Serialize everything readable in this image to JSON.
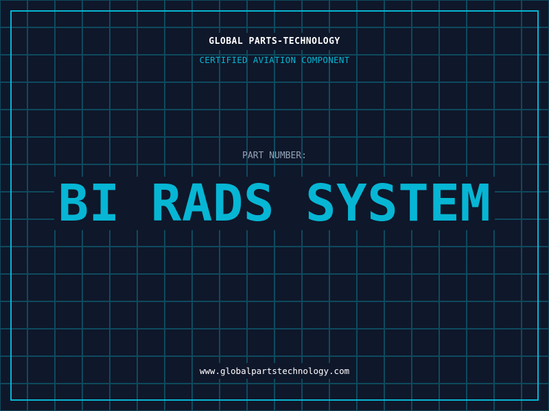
{
  "header": {
    "company": "GLOBAL PARTS-TECHNOLOGY",
    "subtitle": "CERTIFIED AVIATION COMPONENT"
  },
  "main": {
    "part_number_label": "PART NUMBER:",
    "part_number": "BI RADS SYSTEM"
  },
  "footer": {
    "website": "www.globalpartstechnology.com"
  },
  "colors": {
    "background": "#0f172a",
    "grid": "#0e4a5e",
    "accent": "#06b6d4",
    "label": "#94a3b8",
    "text": "#ffffff"
  }
}
